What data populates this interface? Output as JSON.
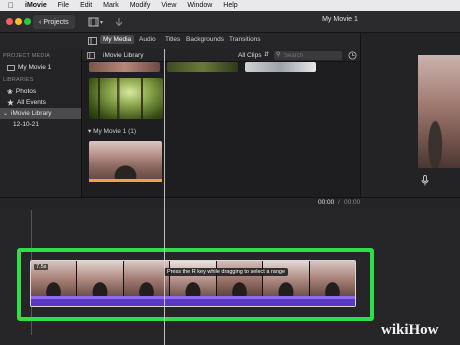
{
  "menubar": {
    "apple_icon": "apple-logo-icon",
    "app_name": "iMovie",
    "items": [
      "File",
      "Edit",
      "Mark",
      "Modify",
      "View",
      "Window",
      "Help"
    ]
  },
  "titlebar": {
    "projects_label": "Projects",
    "window_title": "My Movie 1",
    "traffic_colors": [
      "#fc5f57",
      "#fdbc2e",
      "#28c840"
    ]
  },
  "toolbar": {
    "tabs": [
      "My Media",
      "Audio",
      "Titles",
      "Backgrounds",
      "Transitions"
    ],
    "active_tab": "My Media"
  },
  "sidebar": {
    "project_media_header": "PROJECT MEDIA",
    "project_item": "My Movie 1",
    "libraries_header": "LIBRARIES",
    "photos_item": "Photos",
    "all_events_item": "All Events",
    "library_item": "iMovie Library",
    "date_item": "12-10-21"
  },
  "browser": {
    "library_label": "iMovie Library",
    "filter_label": "All Clips",
    "search_placeholder": "Search",
    "section_label": "My Movie 1",
    "section_count": "(1)"
  },
  "timecode": {
    "current": "00:00",
    "separator": "/",
    "total": "00:00"
  },
  "clip": {
    "duration_badge": "7.5s",
    "tooltip": "Press the R key while dragging to select a range"
  },
  "colors": {
    "highlight": "#2ee046",
    "audio": "#5a38c4"
  },
  "watermark": {
    "wiki": "wiki",
    "how": "How"
  }
}
